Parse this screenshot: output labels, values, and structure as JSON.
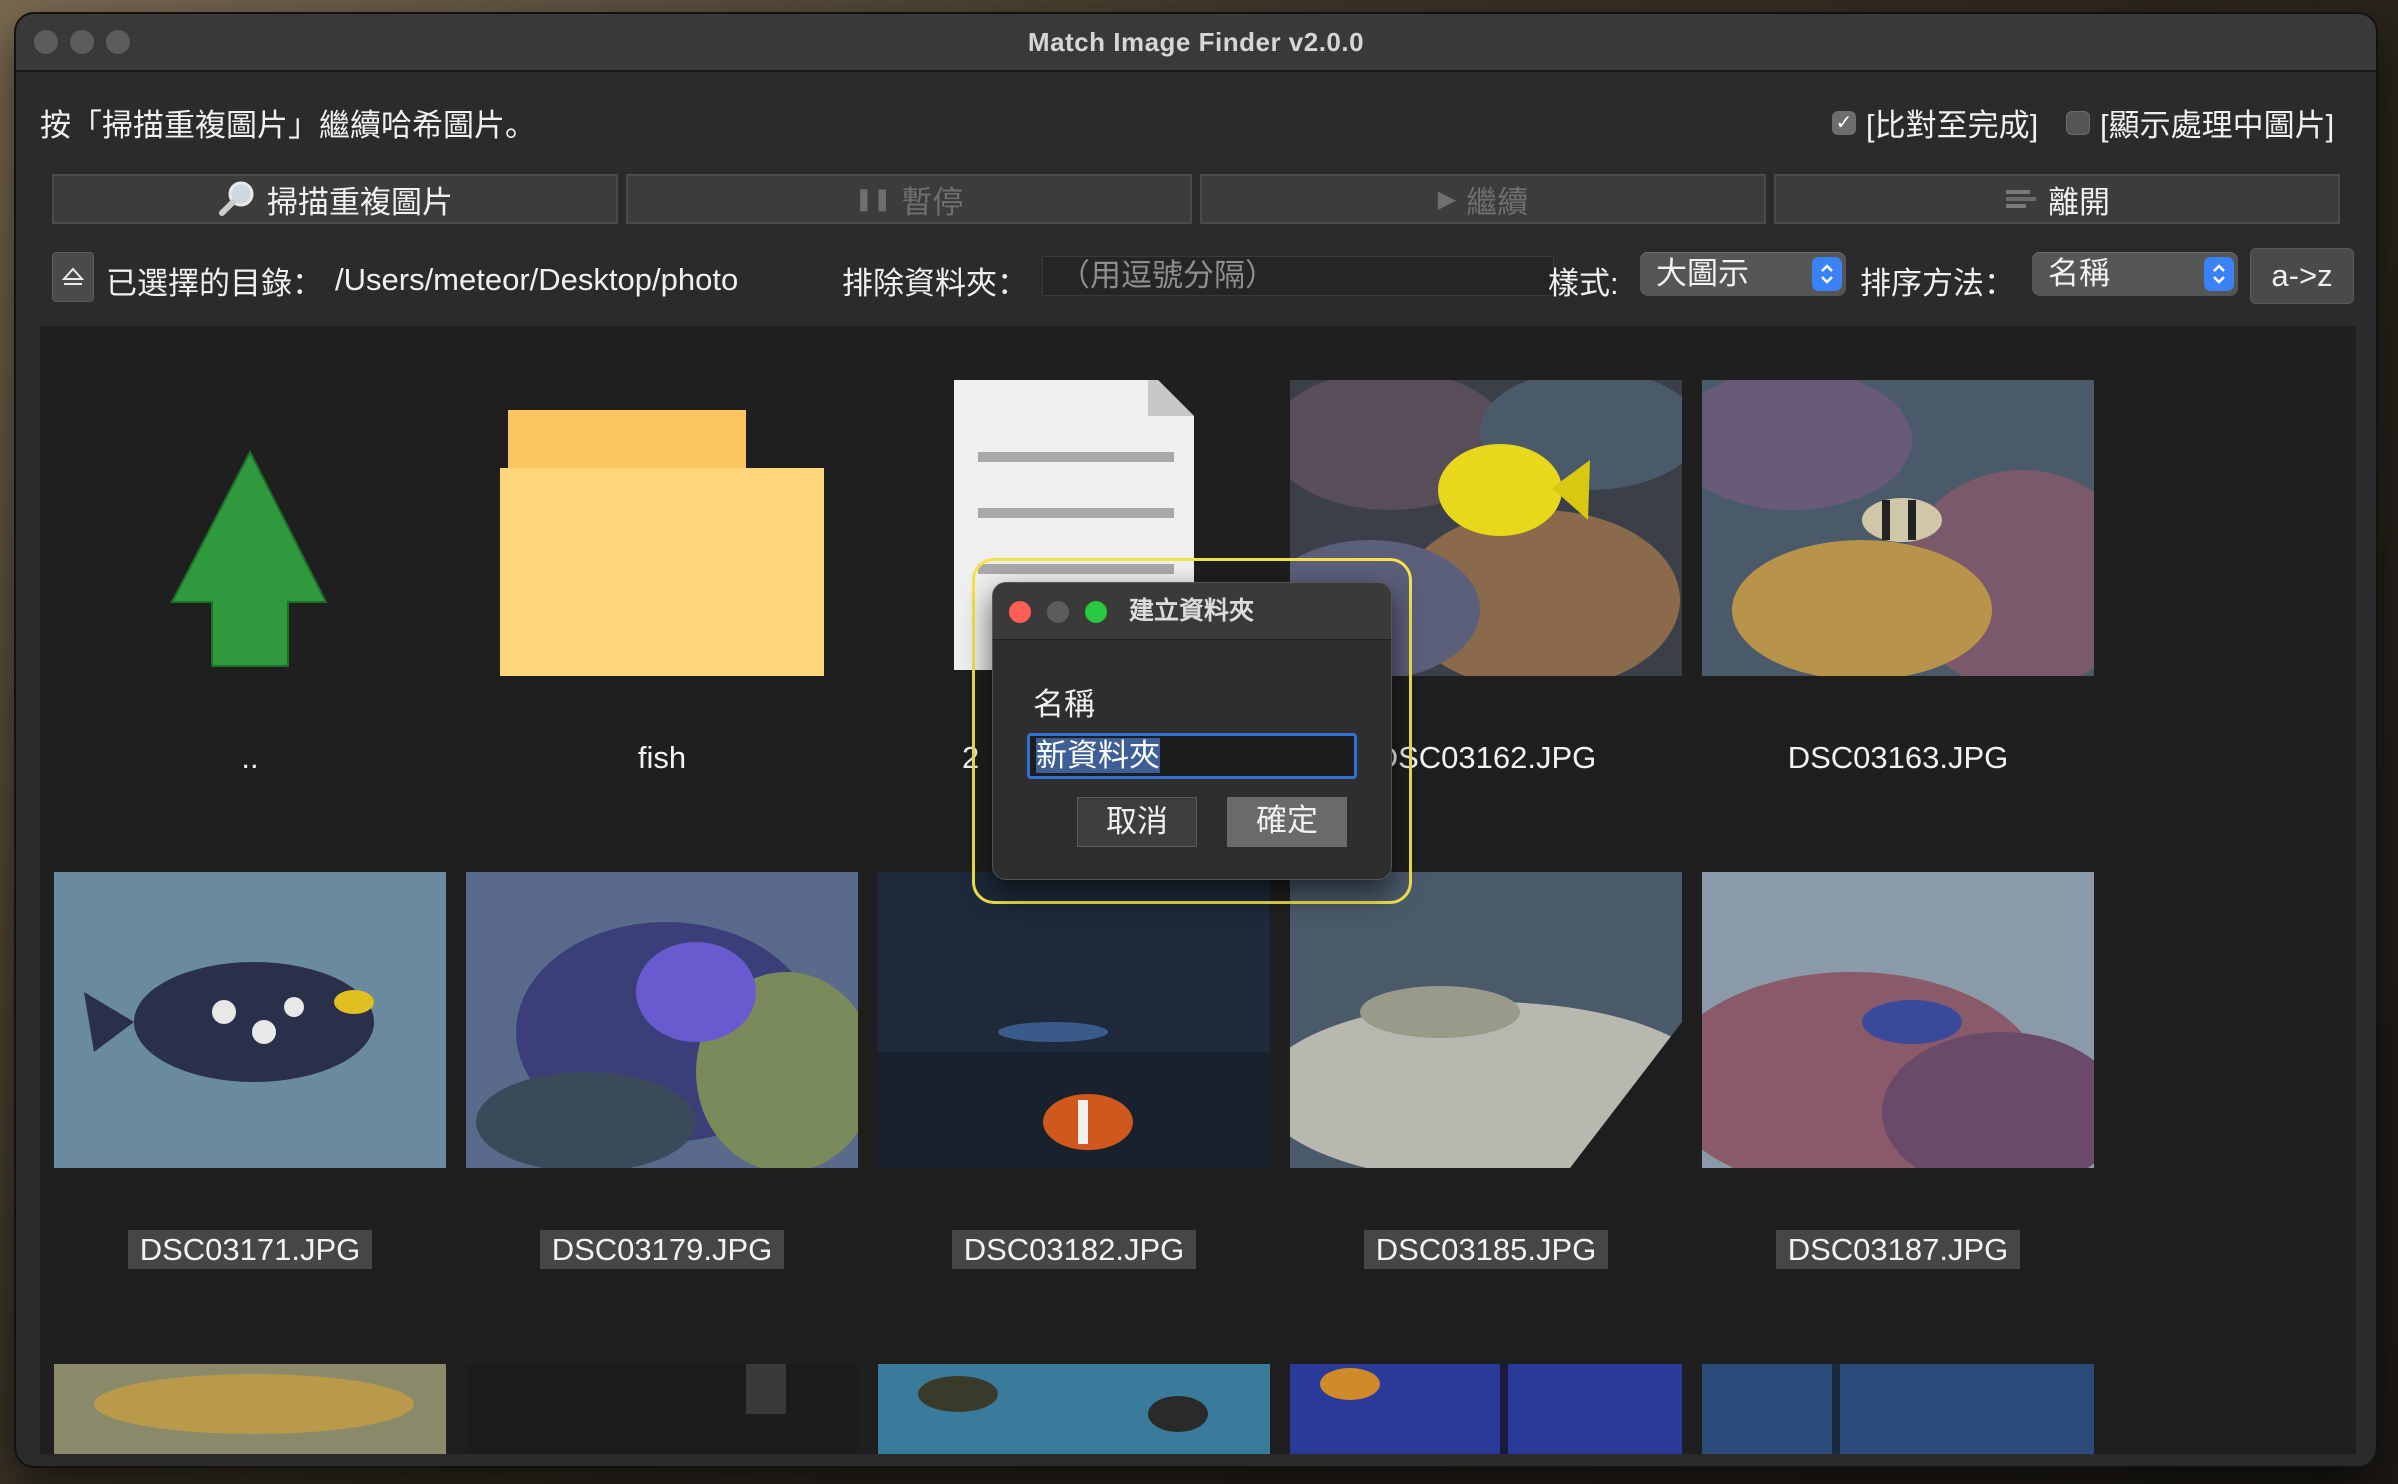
{
  "window": {
    "title": "Match Image Finder v2.0.0"
  },
  "status": "按「掃描重複圖片」繼續哈希圖片。",
  "options": [
    {
      "label": "[比對至完成]",
      "checked": true
    },
    {
      "label": "[顯示處理中圖片]",
      "checked": false
    }
  ],
  "toolbar": {
    "scan": "掃描重複圖片",
    "pause": "暫停",
    "resume": "繼續",
    "quit": "離開"
  },
  "directory": {
    "label": "已選擇的目錄：",
    "path": "/Users/meteor/Desktop/photo"
  },
  "exclude": {
    "label": "排除資料夾：",
    "placeholder": "（用逗號分隔）"
  },
  "style": {
    "label": "樣式:",
    "value": "大圖示"
  },
  "sort": {
    "label": "排序方法：",
    "value": "名稱",
    "order": "a->z"
  },
  "items": [
    {
      "name": "..",
      "kind": "parent-folder-icon"
    },
    {
      "name": "fish",
      "kind": "folder-icon"
    },
    {
      "name": "2",
      "kind": "document-icon"
    },
    {
      "name": "DSC03162.JPG",
      "kind": "photo"
    },
    {
      "name": "DSC03163.JPG",
      "kind": "photo"
    },
    {
      "name": "DSC03171.JPG",
      "kind": "photo"
    },
    {
      "name": "DSC03179.JPG",
      "kind": "photo"
    },
    {
      "name": "DSC03182.JPG",
      "kind": "photo"
    },
    {
      "name": "DSC03185.JPG",
      "kind": "photo"
    },
    {
      "name": "DSC03187.JPG",
      "kind": "photo"
    }
  ],
  "dialog": {
    "title": "建立資料夾",
    "label": "名稱",
    "value": "新資料夾",
    "cancel": "取消",
    "ok": "確定"
  }
}
